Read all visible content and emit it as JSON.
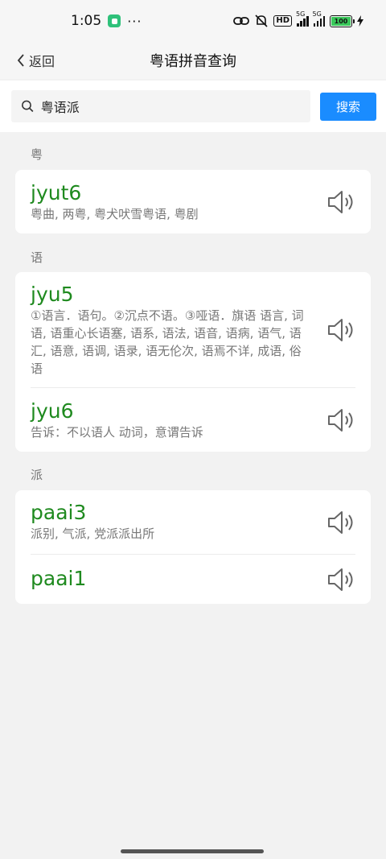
{
  "status_bar": {
    "time": "1:05",
    "dots": "···",
    "hd_label": "HD",
    "net_label_1": "5G",
    "net_label_2": "5G",
    "battery": "100"
  },
  "nav": {
    "back_label": "返回",
    "title": "粤语拼音查询"
  },
  "search": {
    "value": "粤语派",
    "button_label": "搜索"
  },
  "sections": [
    {
      "char": "粤",
      "entries": [
        {
          "jyutping": "jyut6",
          "meaning": "粤曲, 两粤, 粤犬吠雪粤语, 粤剧"
        }
      ]
    },
    {
      "char": "语",
      "entries": [
        {
          "jyutping": "jyu5",
          "meaning": "①语言．语句。②沉点不语。③哑语．旗语 语言, 词语, 语重心长语塞, 语系, 语法, 语音, 语病, 语气, 语汇, 语意, 语调, 语录, 语无伦次, 语焉不详, 成语, 俗语"
        },
        {
          "jyutping": "jyu6",
          "meaning": "告诉：不以语人 动词，意谓告诉"
        }
      ]
    },
    {
      "char": "派",
      "entries": [
        {
          "jyutping": "paai3",
          "meaning": "派别, 气派, 党派派出所"
        },
        {
          "jyutping": "paai1",
          "meaning": ""
        }
      ]
    }
  ],
  "icons": {
    "back": "chevron-left-icon",
    "search": "magnifier-icon",
    "speaker": "speaker-icon"
  },
  "colors": {
    "accent": "#1a8cff",
    "jyutping": "#1f8a1f"
  }
}
